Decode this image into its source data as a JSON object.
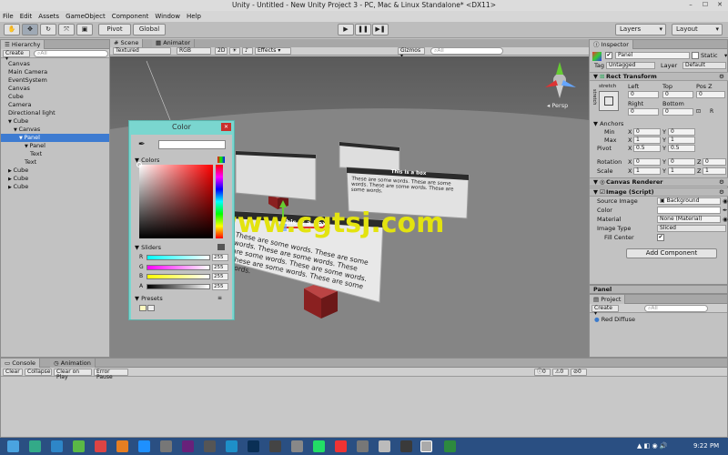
{
  "window": {
    "title": "Unity - Untitled - New Unity Project 3 - PC, Mac & Linux Standalone* <DX11>"
  },
  "menu": [
    "File",
    "Edit",
    "Assets",
    "GameObject",
    "Component",
    "Window",
    "Help"
  ],
  "toolbar": {
    "pivot": "Pivot",
    "global": "Global",
    "layers": "Layers",
    "layout": "Layout"
  },
  "hierarchy": {
    "tab": "Hierarchy",
    "create": "Create",
    "search_placeholder": "All",
    "items": [
      {
        "label": "Canvas",
        "indent": 0,
        "arrow": ""
      },
      {
        "label": "Main Camera",
        "indent": 0,
        "arrow": ""
      },
      {
        "label": "EventSystem",
        "indent": 0,
        "arrow": ""
      },
      {
        "label": "Canvas",
        "indent": 0,
        "arrow": ""
      },
      {
        "label": "Cube",
        "indent": 0,
        "arrow": ""
      },
      {
        "label": "Camera",
        "indent": 0,
        "arrow": ""
      },
      {
        "label": "Directional light",
        "indent": 0,
        "arrow": ""
      },
      {
        "label": "Cube",
        "indent": 0,
        "arrow": "▼"
      },
      {
        "label": "Canvas",
        "indent": 1,
        "arrow": "▼"
      },
      {
        "label": "Panel",
        "indent": 2,
        "arrow": "▼",
        "selected": true
      },
      {
        "label": "Panel",
        "indent": 3,
        "arrow": "▼"
      },
      {
        "label": "Text",
        "indent": 4,
        "arrow": ""
      },
      {
        "label": "Text",
        "indent": 3,
        "arrow": ""
      },
      {
        "label": "Cube",
        "indent": 0,
        "arrow": "▶"
      },
      {
        "label": "Cube",
        "indent": 0,
        "arrow": "▶"
      },
      {
        "label": "Cube",
        "indent": 0,
        "arrow": "▶"
      }
    ]
  },
  "scene": {
    "tab_scene": "Scene",
    "tab_animator": "Animator",
    "mode": "Textured",
    "rgb": "RGB",
    "dim": "2D",
    "effects": "Effects",
    "gizmos": "Gizmos",
    "search_placeholder": "All",
    "persp": "Persp",
    "panel_title": "This is a box",
    "panel_text": "These are some words. These are some words. These are some words. These are some words. These are some words. These are some words. These are some words.",
    "small_panel_title": "This is a box",
    "small_panel_text": "These are some words. These are some words. These are some words. These are some words."
  },
  "color_picker": {
    "title": "Color",
    "colors_label": "Colors",
    "sliders_label": "Sliders",
    "presets_label": "Presets",
    "rows": [
      {
        "label": "R",
        "value": "255"
      },
      {
        "label": "G",
        "value": "255"
      },
      {
        "label": "B",
        "value": "255"
      },
      {
        "label": "A",
        "value": "255"
      }
    ]
  },
  "watermark": "www.cgtsj.com",
  "inspector": {
    "tab": "Inspector",
    "object_name": "Panel",
    "static_label": "Static",
    "tag_label": "Tag",
    "tag_value": "Untagged",
    "layer_label": "Layer",
    "layer_value": "Default",
    "rect_transform": "Rect Transform",
    "stretch": "stretch",
    "col_left": "Left",
    "col_top": "Top",
    "col_posz": "Pos Z",
    "left": "0",
    "top": "0",
    "posz": "0",
    "col_right": "Right",
    "col_bottom": "Bottom",
    "right": "0",
    "bottom": "0",
    "anchors": "Anchors",
    "anchor_min": "Min",
    "anchor_max": "Max",
    "pivot": "Pivot",
    "min_x": "0",
    "min_y": "0",
    "max_x": "1",
    "max_y": "1",
    "pivot_x": "0.5",
    "pivot_y": "0.5",
    "rotation": "Rotation",
    "scale": "Scale",
    "rot_x": "0",
    "rot_y": "0",
    "rot_z": "0",
    "scale_x": "1",
    "scale_y": "1",
    "scale_z": "1",
    "canvas_renderer": "Canvas Renderer",
    "image_script": "Image (Script)",
    "source_image_label": "Source Image",
    "source_image_value": "Background",
    "color_label": "Color",
    "material_label": "Material",
    "material_value": "None (Material)",
    "image_type_label": "Image Type",
    "image_type_value": "Sliced",
    "fill_center_label": "Fill Center",
    "add_component": "Add Component",
    "bottom_label": "Panel"
  },
  "project": {
    "tab": "Project",
    "create": "Create",
    "search_placeholder": "All",
    "items": [
      "Red Diffuse"
    ]
  },
  "console": {
    "tab_console": "Console",
    "tab_animation": "Animation",
    "clear": "Clear",
    "collapse": "Collapse",
    "clear_on_play": "Clear on Play",
    "error_pause": "Error Pause",
    "counts": [
      "0",
      "0",
      "0"
    ]
  },
  "taskbar": {
    "time": "9:22 PM"
  },
  "colors": {
    "accent_selection": "#3d7bd1",
    "scene_bg": "#6b6b6b",
    "color_window": "#7ad6cf",
    "taskbar": "#2a4f82"
  }
}
